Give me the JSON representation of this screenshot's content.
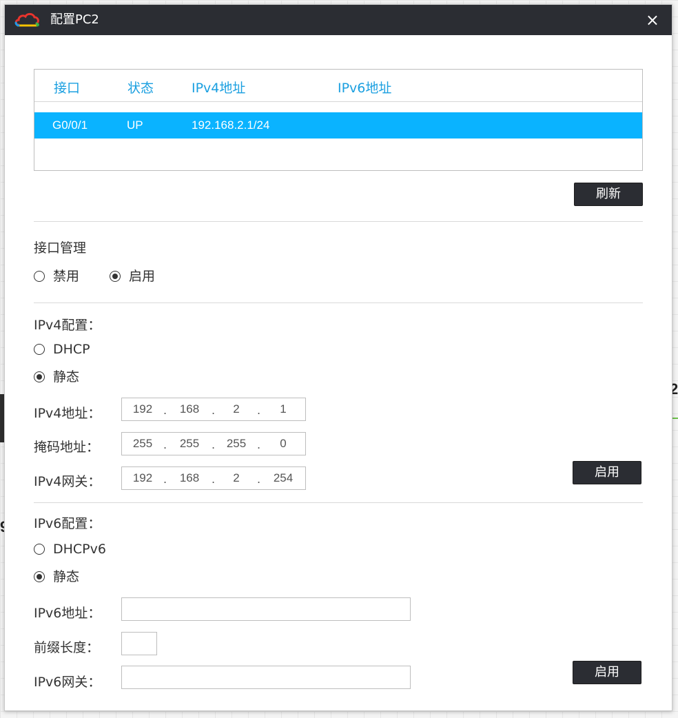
{
  "window": {
    "title": "配置PC2",
    "close": "×"
  },
  "background": {
    "frag1": "2",
    "frag2": "9"
  },
  "interfaces": {
    "headers": [
      "接口",
      "状态",
      "IPv4地址",
      "IPv6地址"
    ],
    "rows": [
      {
        "iface": "G0/0/1",
        "status": "UP",
        "ipv4": "192.168.2.1/24",
        "ipv6": ""
      }
    ],
    "refresh_label": "刷新"
  },
  "iface_mgmt": {
    "title": "接口管理",
    "disable_label": "禁用",
    "enable_label": "启用",
    "selected": "enable"
  },
  "ipv4": {
    "title": "IPv4配置：",
    "dhcp_label": "DHCP",
    "static_label": "静态",
    "mode": "static",
    "address_label": "IPv4地址：",
    "address": [
      "192",
      "168",
      "2",
      "1"
    ],
    "mask_label": "掩码地址：",
    "mask": [
      "255",
      "255",
      "255",
      "0"
    ],
    "gateway_label": "IPv4网关：",
    "gateway": [
      "192",
      "168",
      "2",
      "254"
    ],
    "apply_label": "启用"
  },
  "ipv6": {
    "title": "IPv6配置：",
    "dhcp_label": "DHCPv6",
    "static_label": "静态",
    "mode": "static",
    "address_label": "IPv6地址：",
    "address": "",
    "prefix_label": "前缀长度：",
    "prefix": "",
    "gateway_label": "IPv6网关：",
    "gateway": "",
    "apply_label": "启用"
  },
  "colors": {
    "titlebar": "#2b2d33",
    "accent": "#0ab3ff",
    "header_text": "#1a9fe0",
    "button": "#2b2d33"
  }
}
